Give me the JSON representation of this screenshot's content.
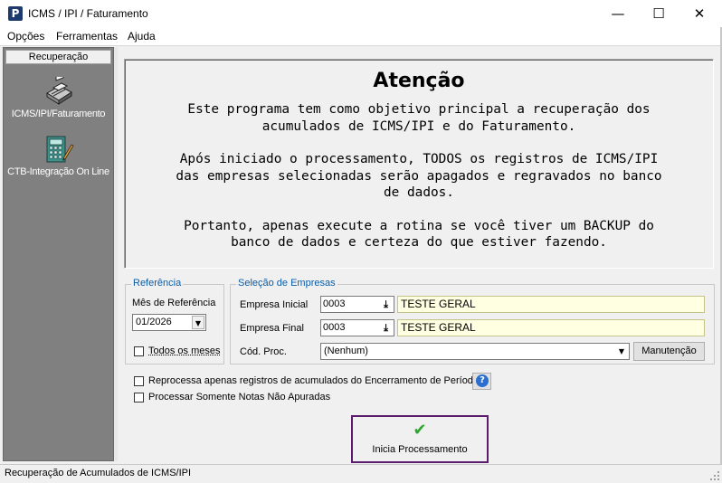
{
  "window": {
    "title": "ICMS / IPI / Faturamento",
    "icon_letter": "P",
    "minimize_glyph": "—",
    "maximize_glyph": "☐",
    "close_glyph": "✕"
  },
  "menu": {
    "items": [
      {
        "label": "Opções"
      },
      {
        "label": "Ferramentas"
      },
      {
        "label": "Ajuda"
      }
    ]
  },
  "sidebar": {
    "header": "Recuperação",
    "items": [
      {
        "label": "ICMS/IPI/Faturamento",
        "icon": "cash-register-icon"
      },
      {
        "label": "CTB-Integração On Line",
        "icon": "calculator-icon"
      }
    ]
  },
  "notice": {
    "title": "Atenção",
    "paragraph1": [
      "Este programa tem como objetivo principal a recuperação dos",
      "acumulados de ICMS/IPI e do Faturamento."
    ],
    "paragraph2": [
      "Após iniciado o processamento, TODOS os registros de ICMS/IPI",
      "das empresas selecionadas serão apagados e regravados no banco",
      "de dados."
    ],
    "paragraph3": [
      "Portanto, apenas execute a rotina se você tiver um BACKUP do",
      "banco de dados e certeza do que estiver fazendo."
    ]
  },
  "referencia": {
    "legend": "Referência",
    "mes_label": "Mês de Referência",
    "mes_value": "01/2026",
    "todos_label": "Todos os meses",
    "todos_checked": false
  },
  "empresas": {
    "legend": "Seleção de Empresas",
    "inicial_label": "Empresa Inicial",
    "inicial_code": "0003",
    "inicial_name": "TESTE GERAL",
    "final_label": "Empresa Final",
    "final_code": "0003",
    "final_name": "TESTE GERAL",
    "proc_label": "Cód. Proc.",
    "proc_value": "(Nenhum)",
    "manutencao_label": "Manutenção"
  },
  "options": {
    "reprocessa_label": "Reprocessa apenas registros de acumulados do Encerramento de Período",
    "reprocessa_checked": false,
    "somente_label": "Processar Somente Notas Não Apuradas",
    "somente_checked": false
  },
  "actions": {
    "start_label": "Inicia Processamento",
    "help_glyph": "?"
  },
  "status": {
    "text": "Recuperação de Acumulados de ICMS/IPI"
  }
}
